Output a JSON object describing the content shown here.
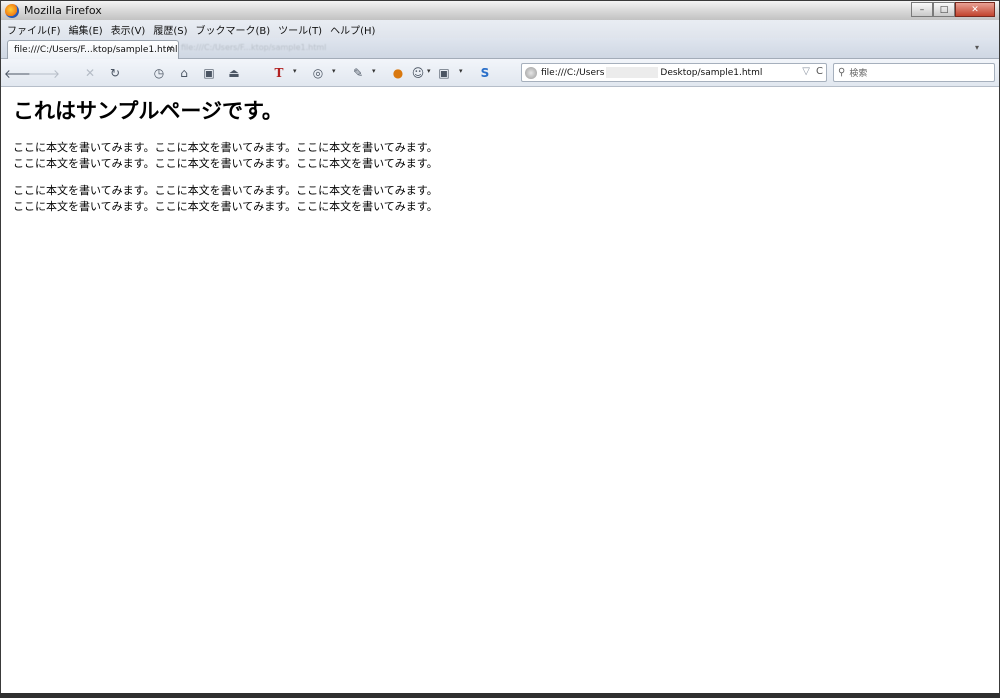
{
  "window": {
    "title": "Mozilla Firefox",
    "controls": {
      "minimize": "–",
      "maximize": "□",
      "close": "✕"
    }
  },
  "menubar": {
    "items": [
      "ファイル(F)",
      "編集(E)",
      "表示(V)",
      "履歴(S)",
      "ブックマーク(B)",
      "ツール(T)",
      "ヘルプ(H)"
    ]
  },
  "tabs": {
    "active": {
      "label": "file:///C:/Users/F...ktop/sample1.html",
      "close": "×"
    },
    "ghost_label": "file:///C:/Users/F...ktop/sample1.html",
    "list_button": "▾"
  },
  "toolbar": {
    "back": "🡐",
    "forward": "🡒",
    "stop": "✕",
    "reload": "↻",
    "history": "◷",
    "home": "⌂",
    "bookmark": "▣",
    "downloads": "⏏",
    "text_tool": "T",
    "dropdown": "▾",
    "addon1": "◎",
    "addon2": "✎",
    "addon3": "●",
    "addon4": "☺",
    "addon5": "▣",
    "addon6": "S"
  },
  "urlbar": {
    "prefix": "file:///C:/Users",
    "suffix": "Desktop/sample1.html",
    "star": "▽",
    "reload": "C"
  },
  "searchbar": {
    "icon": "⚲",
    "placeholder": "検索"
  },
  "page": {
    "heading": "これはサンプルページです。",
    "paragraphs": [
      {
        "lines": [
          "ここに本文を書いてみます。ここに本文を書いてみます。ここに本文を書いてみます。",
          "ここに本文を書いてみます。ここに本文を書いてみます。ここに本文を書いてみます。"
        ]
      },
      {
        "lines": [
          "ここに本文を書いてみます。ここに本文を書いてみます。ここに本文を書いてみます。",
          "ここに本文を書いてみます。ここに本文を書いてみます。ここに本文を書いてみます。"
        ]
      }
    ]
  },
  "colors": {
    "accent": "#1d3f8c",
    "toolbar_bg": "#e1e7ef"
  }
}
